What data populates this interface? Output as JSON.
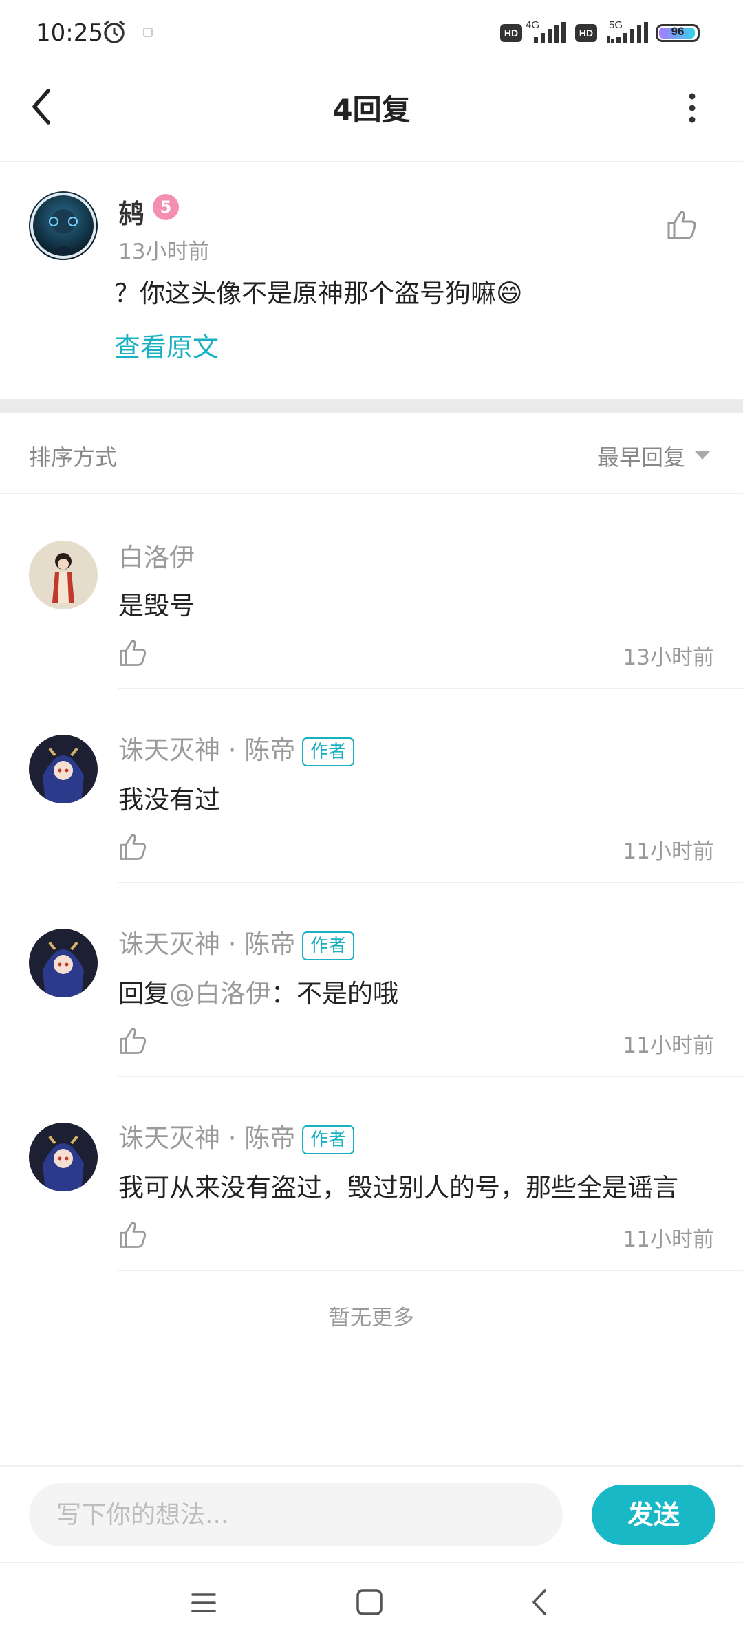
{
  "status_bar": {
    "time": "10:25",
    "network_1": "4G",
    "network_2": "5G",
    "hd_label": "HD",
    "battery": "96",
    "battery_level": 0.96
  },
  "header": {
    "title": "4回复"
  },
  "original_post": {
    "author": "鸫",
    "level": "5",
    "time": "13小时前",
    "content": "？你这头像不是原神那个盗号狗嘛😄",
    "view_original_label": "查看原文"
  },
  "sort": {
    "label": "排序方式",
    "value": "最早回复"
  },
  "replies": [
    {
      "author": "白洛伊",
      "is_author": false,
      "content": "是毁号",
      "time": "13小时前"
    },
    {
      "author": "诛天灭神 · 陈帝",
      "is_author": true,
      "badge": "作者",
      "content": "我没有过",
      "time": "11小时前"
    },
    {
      "author": "诛天灭神 · 陈帝",
      "is_author": true,
      "badge": "作者",
      "content_prefix": "回复",
      "mention": "@白洛伊",
      "content": "：不是的哦",
      "time": "11小时前"
    },
    {
      "author": "诛天灭神 · 陈帝",
      "is_author": true,
      "badge": "作者",
      "content": "我可从来没有盗过，毁过别人的号，那些全是谣言",
      "time": "11小时前"
    }
  ],
  "no_more": "暂无更多",
  "input": {
    "placeholder": "写下你的想法...",
    "send_label": "发送"
  },
  "colors": {
    "accent": "#19b8c6",
    "link": "#19b0c3",
    "text_secondary": "#999999"
  }
}
